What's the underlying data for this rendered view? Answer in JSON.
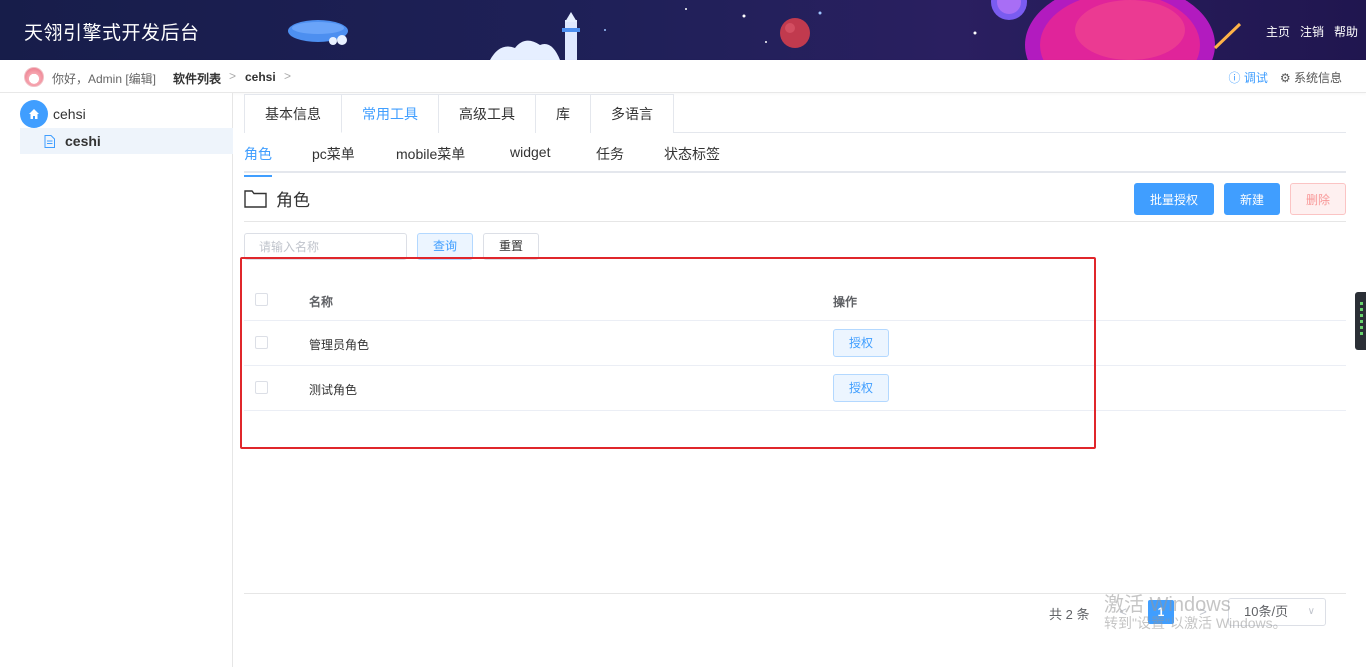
{
  "header": {
    "brand": "天翎引擎式开发后台",
    "nav": [
      "主页",
      "注销",
      "帮助"
    ]
  },
  "crumbbar": {
    "greeting": "你好，Admin [编辑]",
    "crumbs": [
      "软件列表",
      "cehsi"
    ],
    "sep": ">",
    "debug": "调试",
    "sysinfo": "系统信息",
    "debug_icon": "ⓘ",
    "sysinfo_icon": "⚙"
  },
  "sidebar": {
    "root": "cehsi",
    "child": "ceshi"
  },
  "tabs_primary": [
    {
      "label": "基本信息",
      "active": false
    },
    {
      "label": "常用工具",
      "active": true
    },
    {
      "label": "高级工具",
      "active": false
    },
    {
      "label": "库",
      "active": false
    },
    {
      "label": "多语言",
      "active": false
    }
  ],
  "tabs_secondary": [
    {
      "label": "角色",
      "active": true
    },
    {
      "label": "pc菜单",
      "active": false
    },
    {
      "label": "mobile菜单",
      "active": false
    },
    {
      "label": "widget",
      "active": false
    },
    {
      "label": "任务",
      "active": false
    },
    {
      "label": "状态标签",
      "active": false
    }
  ],
  "section": {
    "title": "角色",
    "buttons": {
      "batch": "批量授权",
      "create": "新建",
      "delete": "删除"
    }
  },
  "search": {
    "placeholder": "请输入名称",
    "query": "查询",
    "reset": "重置"
  },
  "table": {
    "headers": {
      "name": "名称",
      "op": "操作"
    },
    "rows": [
      {
        "name": "管理员角色",
        "action": "授权"
      },
      {
        "name": "测试角色",
        "action": "授权"
      }
    ]
  },
  "pagination": {
    "total": "共 2 条",
    "prev": "<",
    "page": "1",
    "next": ">",
    "size": "10条/页",
    "size_arrow": "∨"
  },
  "watermark": {
    "line1": "激活 Windows",
    "line2": "转到\"设置\"以激活 Windows。"
  },
  "colors": {
    "accent": "#409eff",
    "danger": "#f56c6c",
    "highlight": "#e0262b",
    "header_bg": "#1f2058"
  }
}
